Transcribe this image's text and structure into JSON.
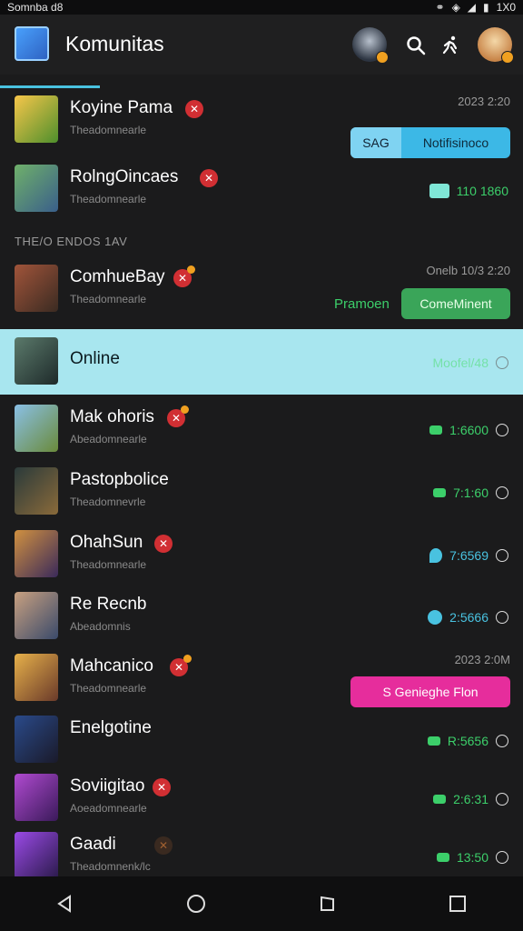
{
  "status_bar": {
    "left_text": "Somnba d8",
    "right_text": "1X0"
  },
  "app_bar": {
    "title": "Komunitas"
  },
  "section_label": "THE/O ENDOS 1AV",
  "rows": [
    {
      "title": "Koyine Pama",
      "subtitle": "Theadomnearle",
      "time": "2023 2:20",
      "action": {
        "type": "split-pill",
        "left": "SAG",
        "right": "Notifisinoco"
      }
    },
    {
      "title": "RolngOincaes",
      "subtitle": "Theadomnearle",
      "meta": "110 1860"
    },
    {
      "title": "ComhueBay",
      "subtitle": "Theadomnearle",
      "time": "Onelb 10/3 2:20",
      "status_text": "Pramoen",
      "action": {
        "type": "button",
        "label": "ComeMinent"
      }
    },
    {
      "title": "Online",
      "meta": "Moofel/48"
    },
    {
      "title": "Mak ohoris",
      "subtitle": "Abeadomnearle",
      "meta": "1:6600"
    },
    {
      "title": "Pastopbolice",
      "subtitle": "Theadomnevrle",
      "meta": "7:1:60"
    },
    {
      "title": "OhahSun",
      "subtitle": "Theadomnearle",
      "meta": "7:6569"
    },
    {
      "title": "Re Recnb",
      "subtitle": "Abeadomnis",
      "meta": "2:5666"
    },
    {
      "title": "Mahcanico",
      "subtitle": "Theadomnearle",
      "time": "2023 2:0M",
      "action": {
        "type": "button",
        "label": "S Genieghe Flon"
      }
    },
    {
      "title": "Enelgotine",
      "meta": "R:5656"
    },
    {
      "title": "Soviigitao",
      "subtitle": "Aoeadomnearle",
      "meta": "2:6:31"
    },
    {
      "title": "Gaadi",
      "subtitle": "Theadomnenk/lc",
      "meta": "13:50"
    }
  ],
  "colors": {
    "background": "#1b1b1c",
    "accent": "#49c2e0",
    "highlight_row": "#a8e6ef",
    "green": "#3ccf6a",
    "magenta": "#e62d9c",
    "badge_red": "#d12f33"
  }
}
